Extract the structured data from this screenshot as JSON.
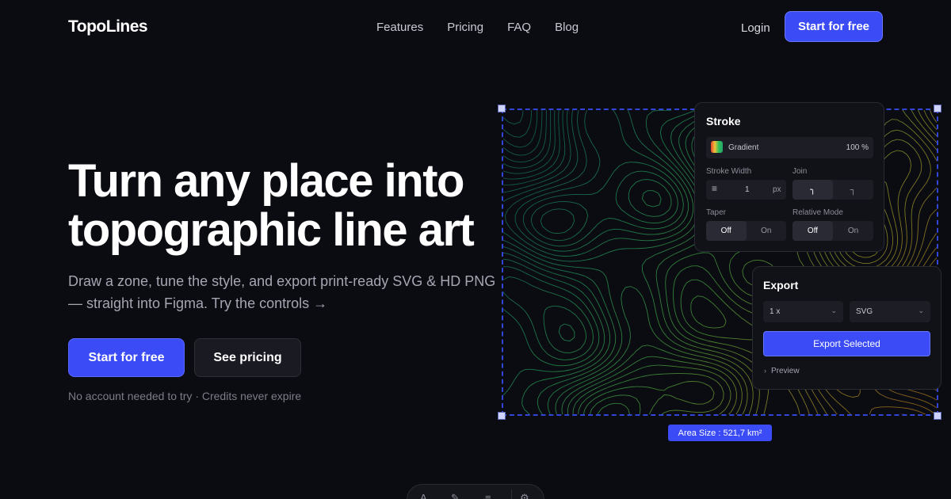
{
  "nav": {
    "logo": "TopoLines",
    "links": [
      "Features",
      "Pricing",
      "FAQ",
      "Blog"
    ],
    "login": "Login",
    "cta": "Start for free"
  },
  "hero": {
    "title": "Turn any place into topographic line art",
    "subtitle": "Draw a zone, tune the style, and export print-ready SVG & HD PNG — straight into Figma. Try the controls →",
    "primary_cta": "Start for free",
    "secondary_cta": "See pricing",
    "note": "No account needed to try · Credits never expire"
  },
  "map": {
    "area_badge": "Area Size : 521,7 km²"
  },
  "stroke_panel": {
    "title": "Stroke",
    "color_mode": "Gradient",
    "opacity": "100 %",
    "stroke_width_label": "Stroke Width",
    "stroke_width_value": "1",
    "stroke_width_unit": "px",
    "join_label": "Join",
    "taper_label": "Taper",
    "taper_off": "Off",
    "taper_on": "On",
    "relative_mode_label": "Relative Mode",
    "relative_off": "Off",
    "relative_on": "On"
  },
  "export_panel": {
    "title": "Export",
    "scale_value": "1 x",
    "format_value": "SVG",
    "export_button": "Export Selected",
    "preview_label": "Preview"
  },
  "colors": {
    "accent": "#3b4cf6",
    "background": "#0b0b12",
    "panel": "#111118"
  },
  "icons": {
    "chevron_down": "chevron-down-icon",
    "chevron_right": "chevron-right-icon",
    "stroke_width": "lines-icon",
    "join_round": "join-round-icon",
    "join_miter": "join-miter-icon",
    "gradient_swatch": "gradient-swatch-icon"
  }
}
